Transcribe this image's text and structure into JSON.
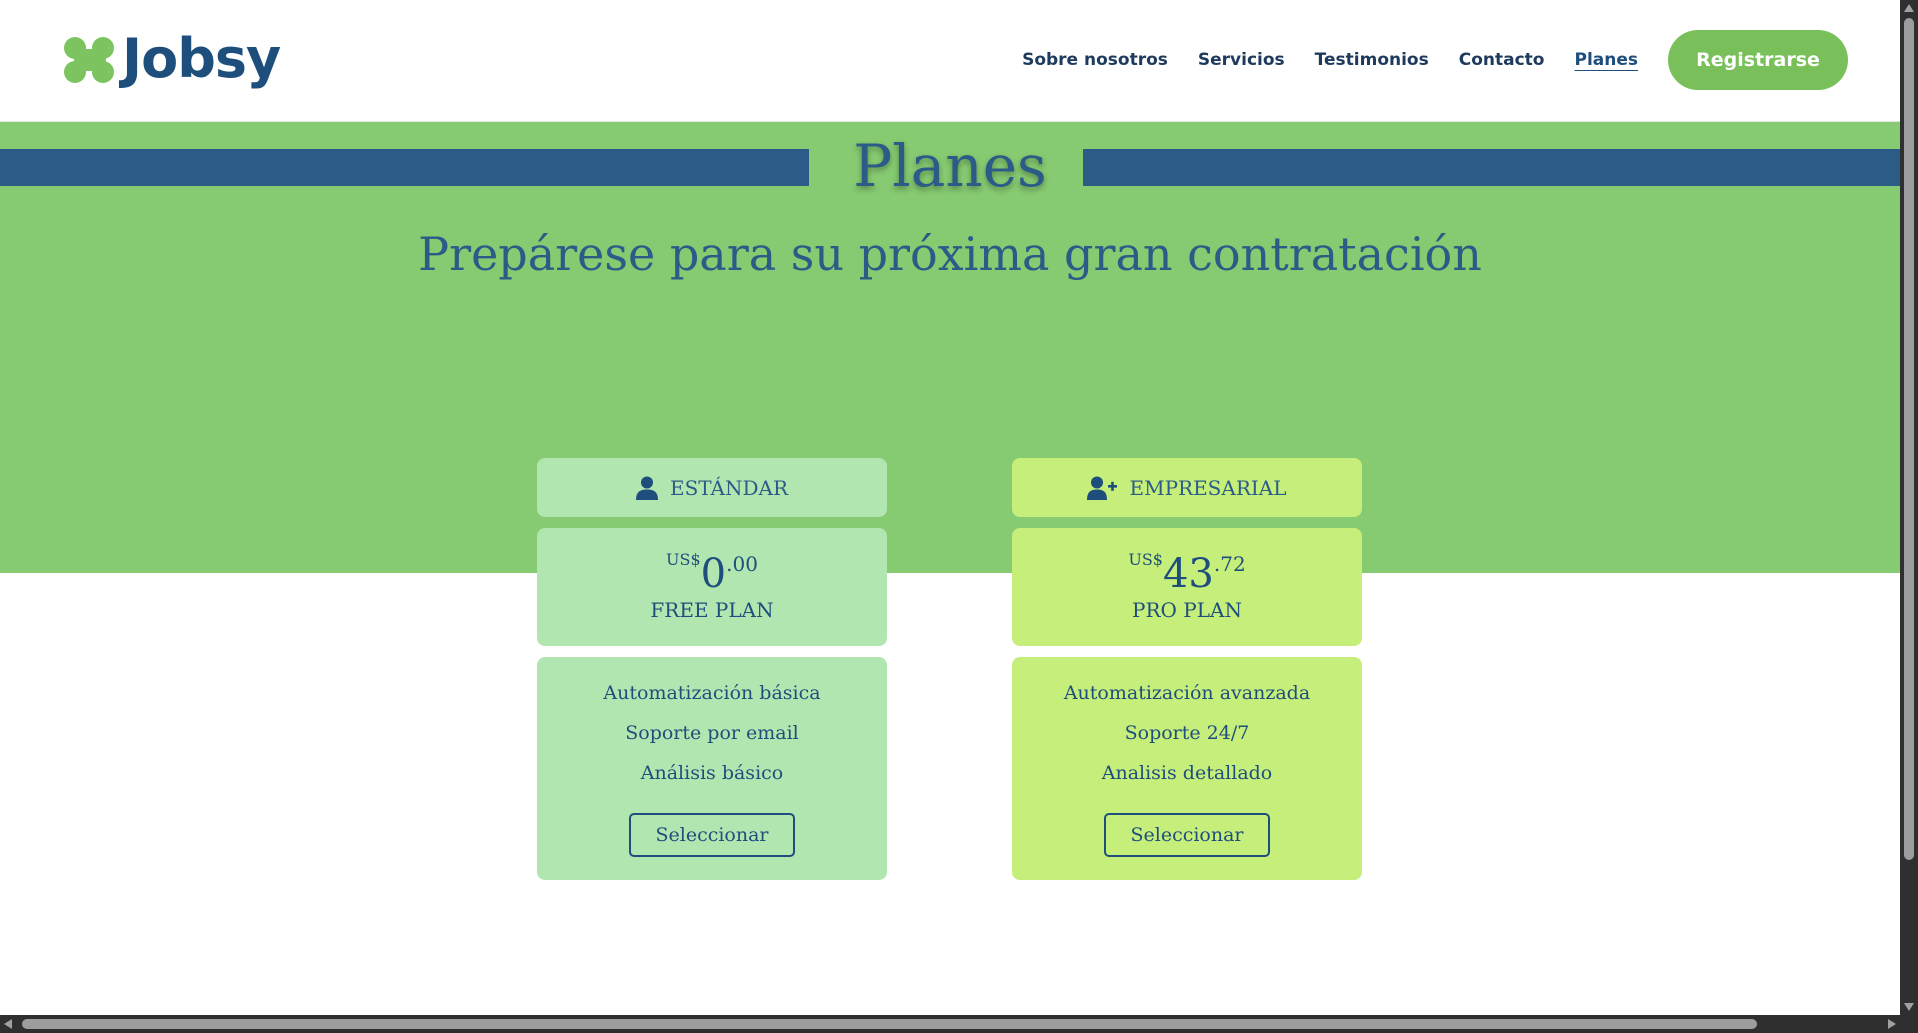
{
  "brand": {
    "name": "Jobsy",
    "accent": "#79c05b",
    "primary": "#1e4e7c"
  },
  "nav": {
    "items": [
      {
        "label": "Sobre nosotros",
        "active": false
      },
      {
        "label": "Servicios",
        "active": false
      },
      {
        "label": "Testimonios",
        "active": false
      },
      {
        "label": "Contacto",
        "active": false
      },
      {
        "label": "Planes",
        "active": true
      }
    ],
    "cta_label": "Registrarse"
  },
  "hero": {
    "title": "Planes",
    "subtitle": "Prepárese para su próxima gran contratación",
    "background": "#86ca71",
    "stripe_color": "#2b5c87"
  },
  "plans": [
    {
      "name": "ESTÁNDAR",
      "icon": "user-icon",
      "currency": "US$",
      "price_int": "0",
      "price_dec": ".00",
      "tier": "FREE PLAN",
      "features": [
        "Automatización básica",
        "Soporte por email",
        "Análisis básico"
      ],
      "button_label": "Seleccionar",
      "color": "#b2e6b0"
    },
    {
      "name": "EMPRESARIAL",
      "icon": "user-plus-icon",
      "currency": "US$",
      "price_int": "43",
      "price_dec": ".72",
      "tier": "PRO PLAN",
      "features": [
        "Automatización avanzada",
        "Soporte 24/7",
        "Analisis detallado"
      ],
      "button_label": "Seleccionar",
      "color": "#c6ee7b"
    }
  ]
}
